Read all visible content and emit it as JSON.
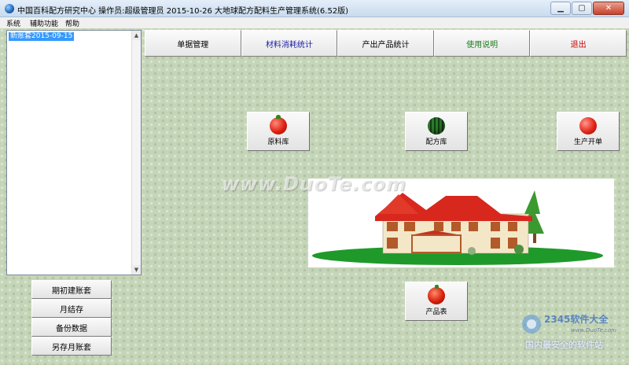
{
  "window": {
    "title": "中国百科配方研究中心   操作员:超级管理员   2015-10-26   大地球配方配料生产管理系统(6.52版)",
    "buttons": {
      "minimize": "▁",
      "maximize": "▢",
      "close": "✕"
    }
  },
  "menubar": {
    "items": [
      "系统",
      "辅助功能",
      "帮助"
    ]
  },
  "account_list": {
    "items": [
      "新账套2015-09-15"
    ]
  },
  "side_buttons": [
    "期初建账套",
    "月结存",
    "备份数据",
    "另存月账套"
  ],
  "tabs": [
    {
      "label": "单据管理",
      "color": "#000000"
    },
    {
      "label": "材料消耗统计",
      "color": "#1a1aa0"
    },
    {
      "label": "产出产品统计",
      "color": "#000000"
    },
    {
      "label": "使用说明",
      "color": "#1a7a1a"
    },
    {
      "label": "退出",
      "color": "#cc0000"
    }
  ],
  "icon_buttons": {
    "raw_material": {
      "label": "原料库",
      "icon": "tomato-icon"
    },
    "formula": {
      "label": "配方库",
      "icon": "watermelon-icon"
    },
    "production": {
      "label": "生产开单",
      "icon": "apple-icon"
    },
    "product_table": {
      "label": "产品表",
      "icon": "pepper-icon"
    }
  },
  "watermark": {
    "text": "www.DuoTe.com"
  },
  "corner_logo": {
    "brand": "2345软件大全",
    "url": "www.DuoTe.com",
    "slogan": "国内最安全的软件站"
  }
}
